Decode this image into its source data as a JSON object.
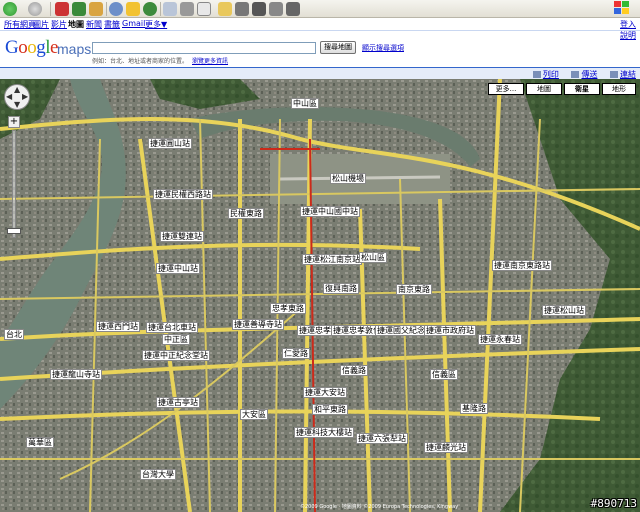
{
  "gbar": {
    "links": [
      "所有網頁",
      "圖片",
      "影片",
      "地圖",
      "新聞",
      "書籤",
      "Gmail",
      "更多▼"
    ],
    "current_index": 3,
    "right_links": [
      "登入",
      "說明"
    ]
  },
  "search": {
    "logo": "Google",
    "maps": "maps",
    "button_label": "搜尋地圖",
    "show_options": "顯示搜尋選項",
    "hint": "例如：台北、地址或者商家的位置。",
    "hint_link": "瀏覽更多資訊"
  },
  "mapbar": {
    "print": "列印",
    "send": "傳送",
    "link": "連結"
  },
  "map_types": [
    "更多...",
    "地圖",
    "衛星",
    "地形"
  ],
  "map_type_selected": 2,
  "map_labels": [
    {
      "t": "中山區"
    },
    {
      "t": "捷運圓山站"
    },
    {
      "t": "捷運民權西路站"
    },
    {
      "t": "捷運中山國中站"
    },
    {
      "t": "捷運雙連站"
    },
    {
      "t": "捷運中山站"
    },
    {
      "t": "捷運松江南京站"
    },
    {
      "t": "松山區"
    },
    {
      "t": "捷運南京東路站"
    },
    {
      "t": "捷運台北車站"
    },
    {
      "t": "捷運善導寺站"
    },
    {
      "t": "捷運忠孝復興站"
    },
    {
      "t": "捷運忠孝敦化站"
    },
    {
      "t": "捷運國父紀念館站"
    },
    {
      "t": "捷運市政府站"
    },
    {
      "t": "捷運永春站"
    },
    {
      "t": "捷運大安站"
    },
    {
      "t": "中正區"
    },
    {
      "t": "捷運中正紀念堂站"
    },
    {
      "t": "捷運龍山寺站"
    },
    {
      "t": "大安區"
    },
    {
      "t": "捷運古亭站"
    },
    {
      "t": "捷運科技大樓站"
    },
    {
      "t": "捷運六張犁站"
    },
    {
      "t": "捷運西門站"
    },
    {
      "t": "松山機場"
    },
    {
      "t": "信義區"
    },
    {
      "t": "萬華區"
    },
    {
      "t": "台灣大學"
    },
    {
      "t": "捷運麟光站"
    },
    {
      "t": "捷運松山站"
    },
    {
      "t": "台北"
    },
    {
      "t": "民權東路"
    },
    {
      "t": "南京東路"
    },
    {
      "t": "忠孝東路"
    },
    {
      "t": "信義路"
    },
    {
      "t": "仁愛路"
    },
    {
      "t": "和平東路"
    },
    {
      "t": "基隆路"
    },
    {
      "t": "復興南路"
    }
  ],
  "copyright": "©2009 Google · 地圖資料 ©2009 Europa Technologies, Kingway",
  "watermark": "#890713"
}
